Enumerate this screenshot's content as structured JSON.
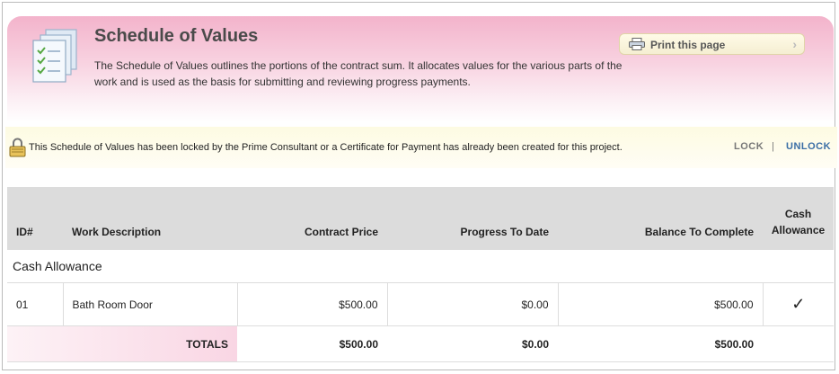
{
  "header": {
    "title": "Schedule of Values",
    "description": "The Schedule of Values outlines the portions of the contract sum. It allocates values for the various parts of the work and is used as the basis for submitting and reviewing progress payments.",
    "icon": "document-checklist-icon",
    "print_button": {
      "label": "Print this page",
      "icon": "printer-icon",
      "chevron": "›"
    }
  },
  "lock_notice": {
    "icon": "lock-icon",
    "message": "This Schedule of Values has been locked by the Prime Consultant or a Certificate for Payment has already been created for this project.",
    "lock_label": "LOCK",
    "separator": "|",
    "unlock_label": "UNLOCK"
  },
  "table": {
    "columns": {
      "id": "ID#",
      "description": "Work Description",
      "contract_price": "Contract Price",
      "progress": "Progress To Date",
      "balance": "Balance To Complete",
      "cash_allowance_1": "Cash",
      "cash_allowance_2": "Allowance"
    },
    "group_label": "Cash Allowance",
    "rows": [
      {
        "id": "01",
        "description": "Bath Room Door",
        "contract_price": "$500.00",
        "progress": "$0.00",
        "balance": "$500.00",
        "cash_allowance": "✓"
      }
    ],
    "totals": {
      "label": "TOTALS",
      "contract_price": "$500.00",
      "progress": "$0.00",
      "balance": "$500.00"
    }
  },
  "colors": {
    "header_pink": "#f3b3cb",
    "lock_link_gray": "#777777",
    "unlock_link_blue": "#3a6ea5",
    "table_header_gray": "#dcdcdc"
  }
}
